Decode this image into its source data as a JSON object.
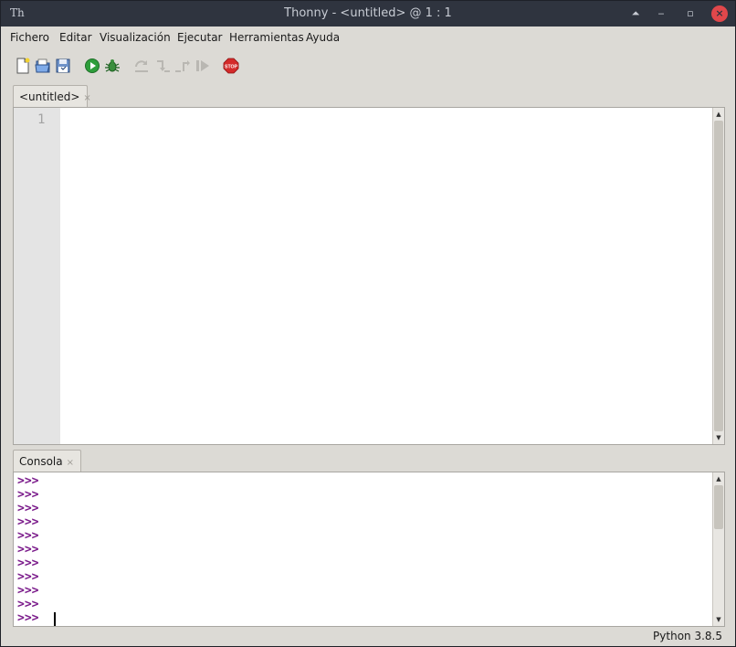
{
  "window": {
    "app_glyph": "Th",
    "title": "Thonny  -  <untitled>  @  1 : 1",
    "controls": {
      "up": "⏶",
      "minimize": "‒",
      "restore": "▫",
      "close": "×"
    }
  },
  "menu": [
    "Fichero",
    "Editar",
    "Visualización",
    "Ejecutar",
    "Herramientas",
    "Ayuda"
  ],
  "toolbar": {
    "icons": [
      "new-file-icon",
      "open-file-icon",
      "save-file-icon",
      "run-icon",
      "debug-icon",
      "step-over-icon",
      "step-into-icon",
      "step-out-icon",
      "resume-icon",
      "stop-icon"
    ],
    "stop_label": "STOP"
  },
  "editor": {
    "tab_label": "<untitled>",
    "tab_close": "×",
    "line_numbers": [
      "1"
    ]
  },
  "console": {
    "tab_label": "Consola",
    "tab_close": "×",
    "prompts": [
      ">>>",
      ">>>",
      ">>>",
      ">>>",
      ">>>",
      ">>>",
      ">>>",
      ">>>",
      ">>>",
      ">>>",
      ">>>"
    ]
  },
  "status": {
    "python_version": "Python 3.8.5"
  },
  "colors": {
    "titlebar": "#2f343f",
    "close": "#e0474b",
    "prompt": "#7a1a8a",
    "run": "#2e9e3b",
    "stop": "#d42a2a"
  }
}
